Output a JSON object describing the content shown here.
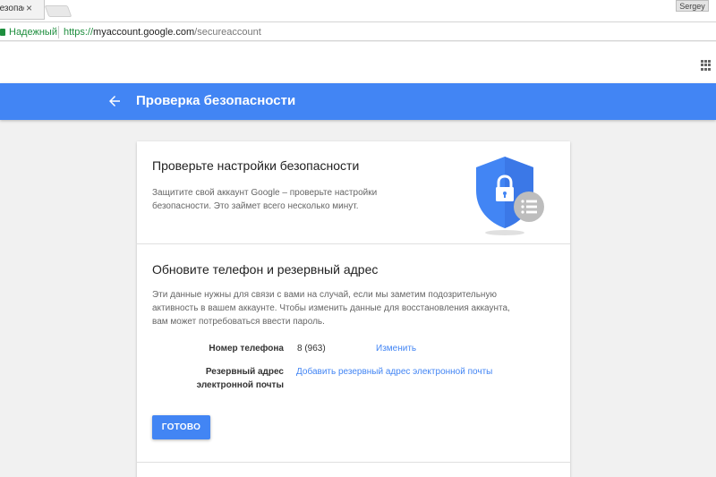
{
  "browser": {
    "tab_title": "Безопасность",
    "tab_close": "×",
    "profile_name": "Sergey",
    "secure_label": "Надежный",
    "url_scheme": "https://",
    "url_host": "myaccount.google.com",
    "url_path": "/secureaccount"
  },
  "header": {
    "title": "Проверка безопасности",
    "accent_color": "#4285f4"
  },
  "intro": {
    "title": "Проверьте настройки безопасности",
    "description": "Защитите свой аккаунт Google – проверьте настройки безопасности. Это займет всего несколько минут."
  },
  "recovery": {
    "title": "Обновите телефон и резервный адрес",
    "description": "Эти данные нужны для связи с вами на случай, если мы заметим подозрительную активность в вашем аккаунте. Чтобы изменить данные для восстановления аккаунта, вам может потребоваться ввести пароль.",
    "phone_label": "Номер телефона",
    "phone_value": "8 (963)",
    "change_link": "Изменить",
    "email_label": "Резервный адрес электронной почты",
    "add_email_link": "Добавить резервный адрес электронной почты",
    "done_button": "ГОТОВО"
  },
  "icons": {
    "back": "arrow-left-icon",
    "shield": "shield-lock-icon",
    "apps": "apps-grid-icon"
  }
}
